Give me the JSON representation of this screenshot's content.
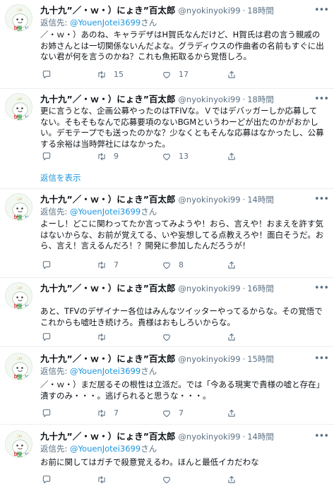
{
  "icons": {
    "more": "more-horizontal-icon",
    "reply": "reply-icon",
    "retweet": "retweet-icon",
    "like": "heart-icon",
    "share": "share-icon"
  },
  "colors": {
    "link": "#1b95e0",
    "secondary_text": "#5b7083",
    "divider": "#ebeef0",
    "thread_line": "#c4cfd6"
  },
  "show_replies_label": "返信を表示",
  "tweets": [
    {
      "name": "九十九”／・ｗ・）にょき”百太郎",
      "handle": "@nyokinyoki99",
      "dot": "·",
      "time": "18時間",
      "reply_prefix": "返信先: ",
      "reply_to": "@YouenJotei3699",
      "reply_suffix": "さん",
      "text": "／・ｗ・）あのね、キャラデザはH賀氏なんだけど、H賀氏は君の言う親戚のお姉さんとは一切関係ないんだよな。グラディウスの作曲者の名前もすぐに出ない君が何を言うのかね？これも魚拓取るから覚悟しろ。",
      "replies": "",
      "retweets": "15",
      "likes": "17"
    },
    {
      "name": "九十九”／・ｗ・）にょき”百太郎",
      "handle": "@nyokinyoki99",
      "dot": "·",
      "time": "18時間",
      "reply_prefix": "",
      "reply_to": "",
      "reply_suffix": "",
      "text": "更に言うとな、企画公募やったのはTFIVな。Ｖではデバッガーしか応募してない。そもそもなんで応募要項のないBGMというわーどが出たのかがおかしい。デモテープでも送ったのかな？少なくともそんな応募はなかったし、公募する余裕は当時弊社にはなかった。",
      "replies": "",
      "retweets": "9",
      "likes": "13"
    },
    {
      "name": "九十九”／・ｗ・）にょき”百太郎",
      "handle": "@nyokinyoki99",
      "dot": "·",
      "time": "14時間",
      "reply_prefix": "返信先: ",
      "reply_to": "@YouenJotei3699",
      "reply_suffix": "さん",
      "text": "よーし！どこに関わってたか言ってみようや！おら、言えや！おまえを許す気はないからな、お前が覚えてる、いや妄想してる点教えろや！面白そうだ。おら、言え！言えるんだろ！？開発に参加したんだろうが！",
      "replies": "",
      "retweets": "7",
      "likes": "8"
    },
    {
      "name": "九十九”／・ｗ・）にょき”百太郎",
      "handle": "@nyokinyoki99",
      "dot": "·",
      "time": "16時間",
      "reply_prefix": "",
      "reply_to": "",
      "reply_suffix": "",
      "text": "あと、TFVのデザイナー各位はみんなツイッターやってるからな。その覚悟でこれからも嘘吐き続けろ。貴様はおもしろいからな。",
      "replies": "",
      "retweets": "",
      "likes": ""
    },
    {
      "name": "九十九”／・ｗ・）にょき”百太郎",
      "handle": "@nyokinyoki99",
      "dot": "·",
      "time": "15時間",
      "reply_prefix": "返信先: ",
      "reply_to": "@YouenJotei3699",
      "reply_suffix": "さん",
      "text": "／・ｗ・）まだ居るその根性は立派だ。では「今ある現実で貴様の嘘と存在」潰すのみ・・・。逃げられると思うな・・・。",
      "replies": "",
      "retweets": "7",
      "likes": "7"
    },
    {
      "name": "九十九”／・ｗ・）にょき”百太郎",
      "handle": "@nyokinyoki99",
      "dot": "·",
      "time": "14時間",
      "reply_prefix": "返信先: ",
      "reply_to": "@YouenJotei3699",
      "reply_suffix": "さん",
      "text": "お前に関してはガチで殺意覚えるわ。ほんと最低イカだわな",
      "replies": "",
      "retweets": "",
      "likes": ""
    }
  ]
}
